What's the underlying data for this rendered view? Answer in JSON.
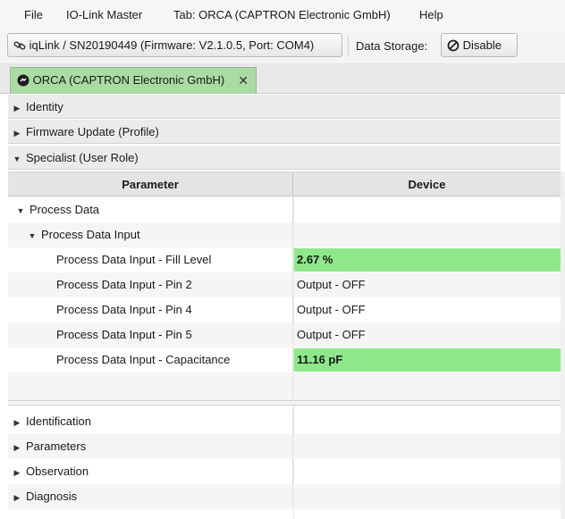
{
  "menubar": {
    "items": [
      "File",
      "IO-Link Master",
      "Tab: ORCA (CAPTRON Electronic GmbH)",
      "Help"
    ]
  },
  "toolbar": {
    "device_label": "iqLink / SN20190449 (Firmware: V2.1.0.5, Port: COM4)",
    "data_storage_label": "Data Storage:",
    "disable_label": "Disable"
  },
  "tab": {
    "label": "ORCA (CAPTRON Electronic GmbH)",
    "close": "✕",
    "color": "#a9dba2"
  },
  "sections": {
    "identity": "Identity",
    "firmware": "Firmware Update (Profile)",
    "specialist": "Specialist (User Role)"
  },
  "table": {
    "headers": {
      "parameter": "Parameter",
      "device": "Device"
    },
    "process_data": "Process Data",
    "process_data_input": "Process Data Input",
    "rows": [
      {
        "param": "Process Data Input - Fill Level",
        "value": "2.67 %"
      },
      {
        "param": "Process Data Input - Pin 2",
        "value": "Output - OFF"
      },
      {
        "param": "Process Data Input - Pin 4",
        "value": "Output - OFF"
      },
      {
        "param": "Process Data Input - Pin 5",
        "value": "Output - OFF"
      },
      {
        "param": "Process Data Input - Capacitance",
        "value": "11.16 pF"
      }
    ],
    "highlight_color": "#8ee88a",
    "groups": [
      "Identification",
      "Parameters",
      "Observation",
      "Diagnosis"
    ]
  }
}
